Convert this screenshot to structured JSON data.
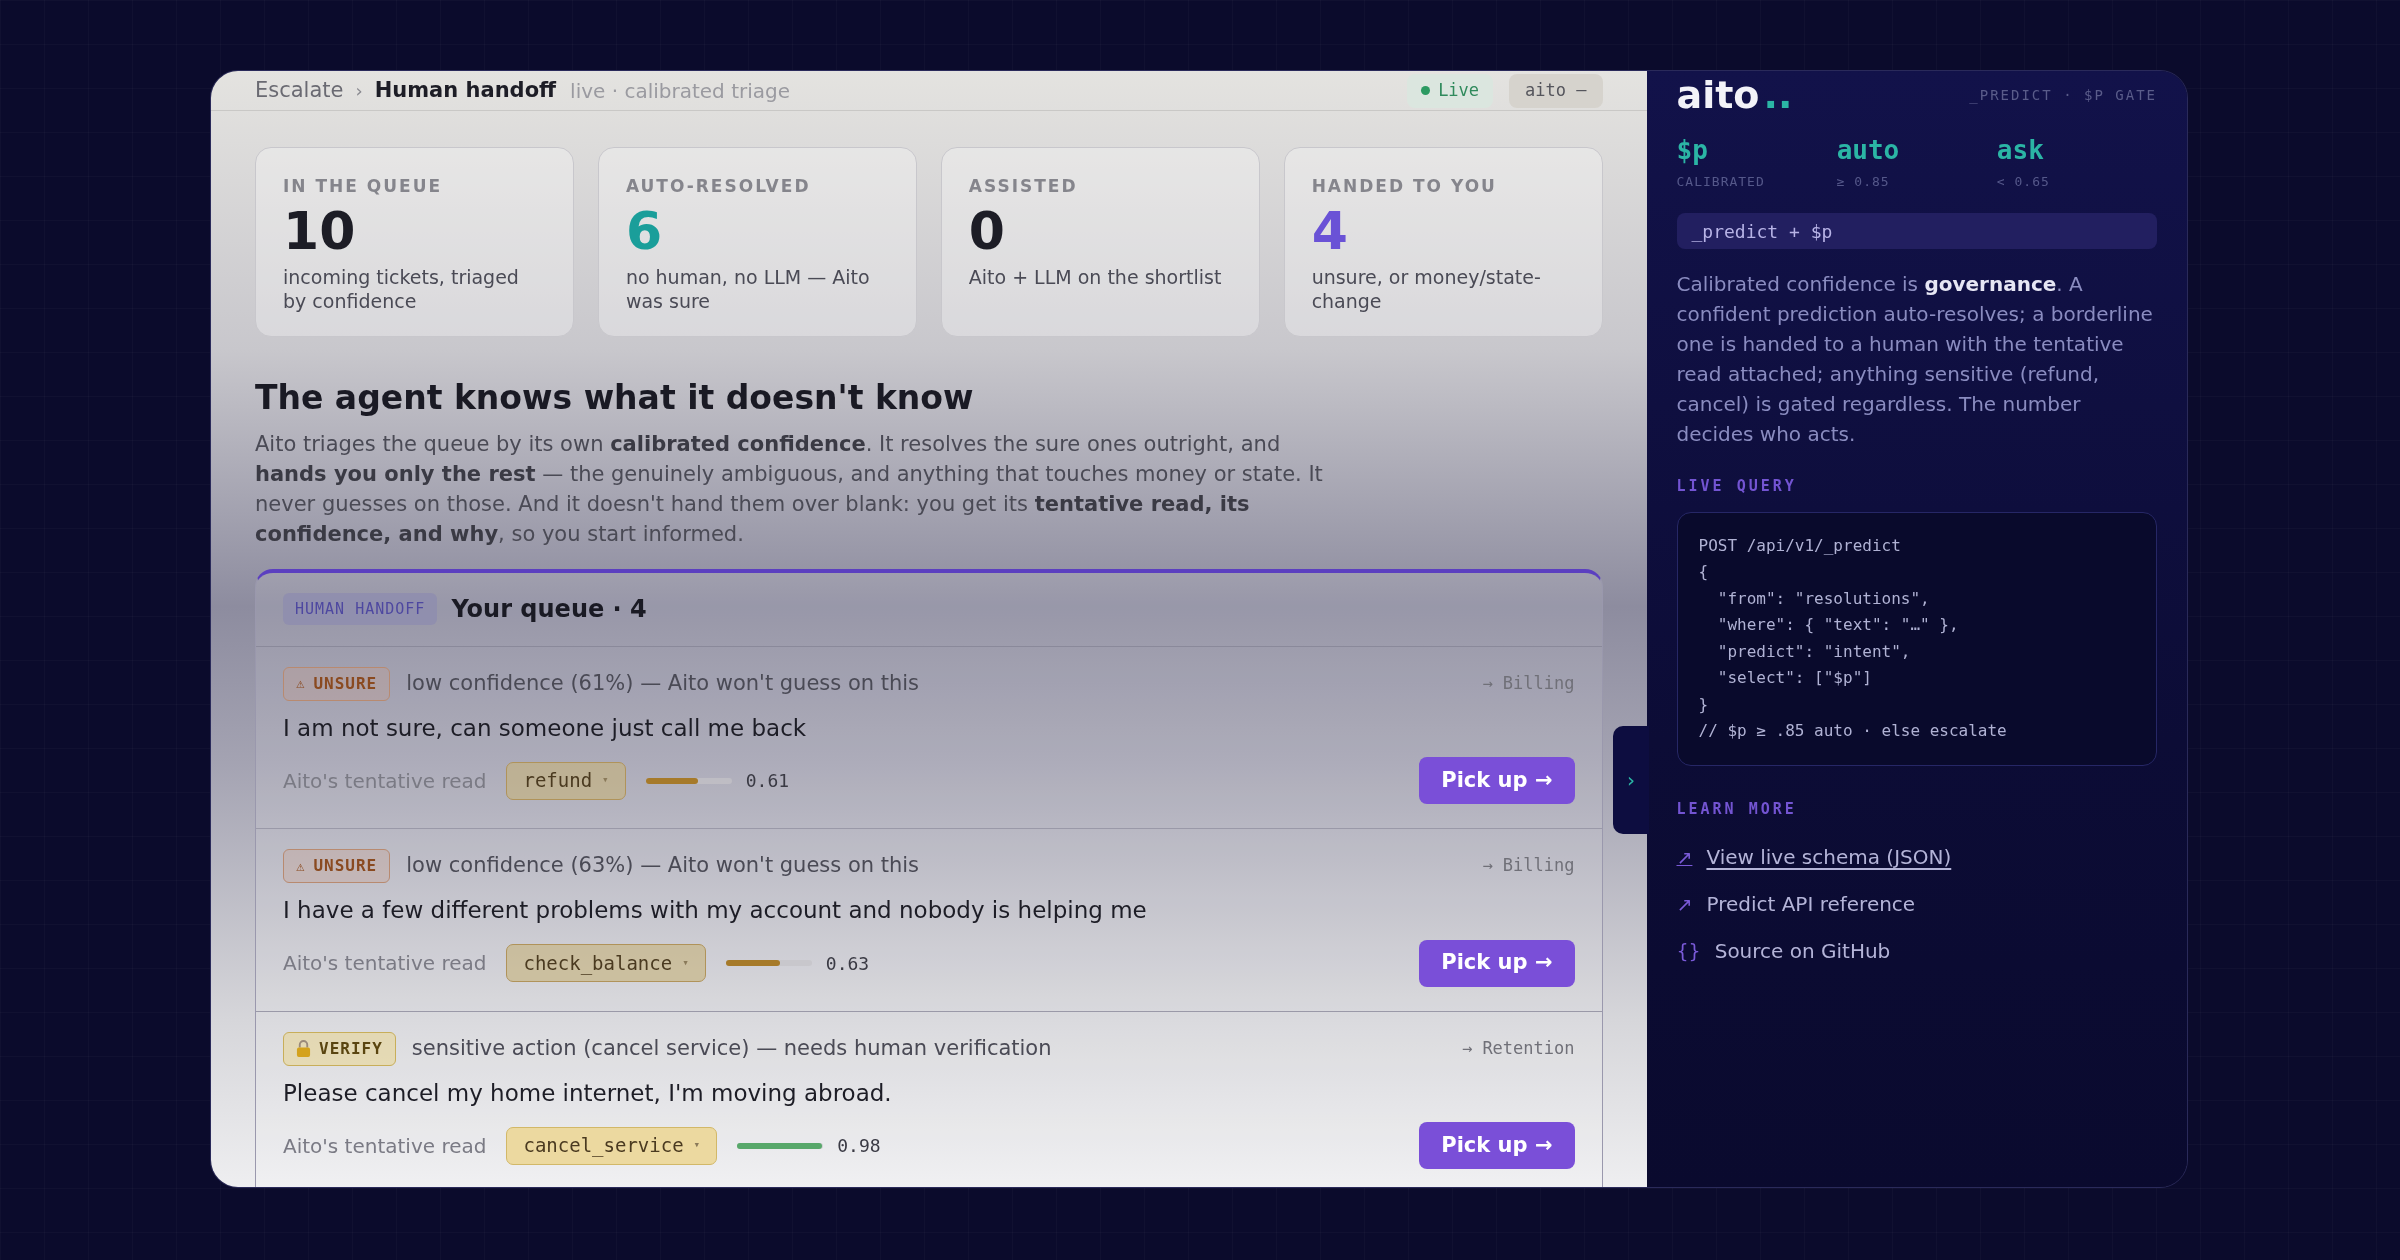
{
  "breadcrumb": {
    "parent": "Escalate",
    "separator": "›",
    "current": "Human handoff",
    "subtitle": "live · calibrated triage"
  },
  "status_badge": {
    "label": "Live"
  },
  "user_badge": {
    "label": "aito –"
  },
  "stats": [
    {
      "label": "IN THE QUEUE",
      "value": "10",
      "caption": "incoming tickets, triaged by confidence",
      "color": "#1d1d26"
    },
    {
      "label": "AUTO-RESOLVED",
      "value": "6",
      "caption": "no human, no LLM — Aito was sure",
      "color": "#1a9e9a"
    },
    {
      "label": "ASSISTED",
      "value": "0",
      "caption": "Aito + LLM on the shortlist",
      "color": "#1d1d26"
    },
    {
      "label": "HANDED TO YOU",
      "value": "4",
      "caption": "unsure, or money/state-change",
      "color": "#6a52d6"
    }
  ],
  "section": {
    "title": "The agent knows what it doesn't know",
    "paragraph": "Aito triages the queue by its own **calibrated confidence**. It resolves the sure ones outright, and **hands you only the rest** — the genuinely ambiguous, and anything that touches money or state. It never guesses on those. And it doesn't hand them over blank: you get its **tentative read, its confidence, and why**, so you start informed."
  },
  "queue": {
    "tag": "HUMAN HANDOFF",
    "title": "Your queue · 4",
    "items": [
      {
        "kind": "unsure",
        "badge_icon": "⚠",
        "badge": "UNSURE",
        "reason": "low confidence (61%) — Aito won't guess on this",
        "route": "→ Billing",
        "message": "I am not sure, can someone just call me back",
        "read_label": "Aito's tentative read",
        "intent": "refund",
        "caret": "▾",
        "level": 0.61,
        "score": "0.61",
        "button": "Pick up →"
      },
      {
        "kind": "unsure",
        "badge_icon": "⚠",
        "badge": "UNSURE",
        "reason": "low confidence (63%) — Aito won't guess on this",
        "route": "→ Billing",
        "message": "I have a few different problems with my account and nobody is helping me",
        "read_label": "Aito's tentative read",
        "intent": "check_balance",
        "caret": "▾",
        "level": 0.63,
        "score": "0.63",
        "button": "Pick up →"
      },
      {
        "kind": "verify",
        "badge": "VERIFY",
        "reason": "sensitive action (cancel service) — needs human verification",
        "route": "→ Retention",
        "message": "Please cancel my home internet, I'm moving abroad.",
        "read_label": "Aito's tentative read",
        "intent": "cancel_service",
        "caret": "▾",
        "level": 0.98,
        "score": "0.98",
        "button": "Pick up →"
      }
    ]
  },
  "panel_toggle": {
    "label": "›"
  },
  "sidebar": {
    "brand": "aito",
    "brand_mark": "..",
    "tagline": "_PREDICT · $P GATE",
    "metrics": [
      {
        "value": "$p",
        "caption": "CALIBRATED"
      },
      {
        "value": "auto",
        "caption": "≥ 0.85"
      },
      {
        "value": "ask",
        "caption": "< 0.65"
      }
    ],
    "chip": "_predict + $p",
    "description": "Calibrated confidence is **governance**. A confident prediction auto-resolves; a borderline one is handed to a human with the tentative read attached; anything sensitive (refund, cancel) is gated regardless. The number decides who acts.",
    "live_query_label": "LIVE QUERY",
    "code_lines": [
      "POST /api/v1/_predict",
      "{",
      "  \"from\": \"resolutions\",",
      "  \"where\": { \"text\": \"…\" },",
      "  \"predict\": \"intent\",",
      "  \"select\": [\"$p\"]",
      "}",
      "// $p ≥ .85 auto · else escalate"
    ],
    "learn_more_label": "LEARN MORE",
    "links": [
      {
        "icon": "↗",
        "label": "View live schema (JSON)",
        "underlined": true
      },
      {
        "icon": "↗",
        "label": "Predict API reference",
        "underlined": false
      },
      {
        "icon": "{}",
        "label": "Source on GitHub",
        "underlined": false
      }
    ]
  }
}
